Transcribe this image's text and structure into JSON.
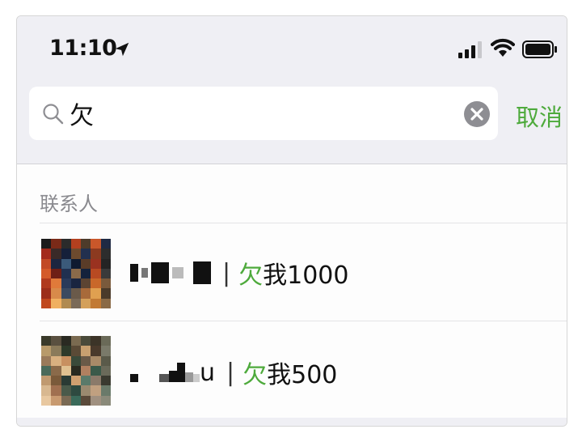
{
  "status_bar": {
    "time": "11:10",
    "icons": [
      "location-arrow-icon",
      "signal-icon",
      "wifi-icon",
      "battery-icon"
    ]
  },
  "search": {
    "value": "欠",
    "placeholder": "",
    "cancel_label": "取消"
  },
  "section": {
    "title": "联系人"
  },
  "contacts": [
    {
      "name_visible": "",
      "separator": "|",
      "remark_match": "欠",
      "remark_rest": "我1000"
    },
    {
      "name_visible": "u",
      "separator": "|",
      "remark_match": "欠",
      "remark_rest": "我500"
    }
  ],
  "colors": {
    "accent": "#4eaa3c",
    "bar_background": "#efeff4",
    "muted_text": "#8a8a8f"
  }
}
